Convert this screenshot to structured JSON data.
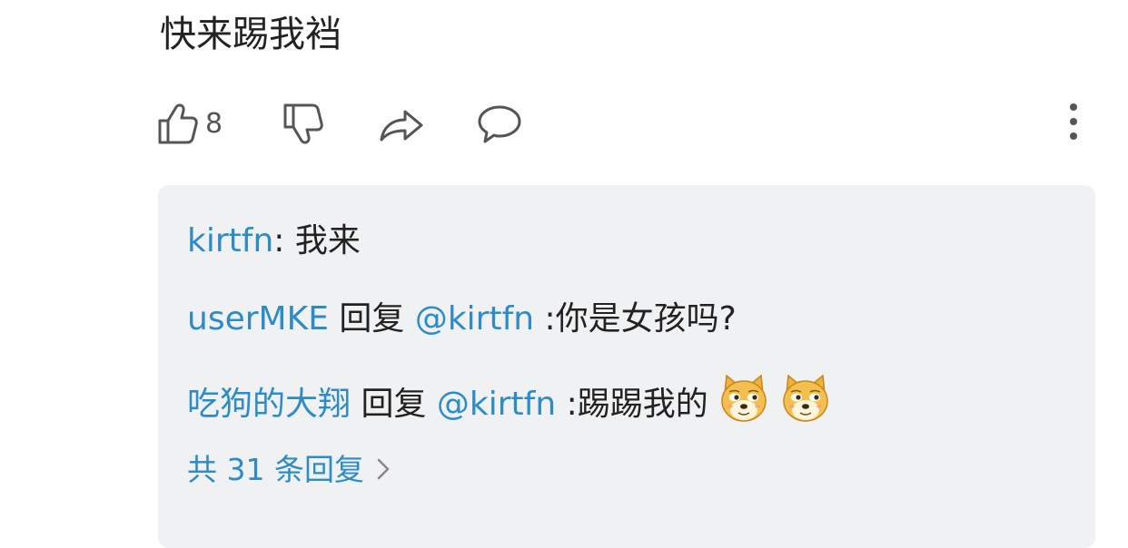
{
  "comment": {
    "text": "快来踢我裆",
    "like_count": "8"
  },
  "actions": {
    "like_icon": "thumbs-up-icon",
    "dislike_icon": "thumbs-down-icon",
    "share_icon": "share-icon",
    "reply_icon": "comment-bubble-icon",
    "more_icon": "more-vertical-icon"
  },
  "replies": [
    {
      "user": "kirtfn",
      "separator": ": ",
      "text": "我来"
    },
    {
      "user": "userMKE",
      "verb": " 回复 ",
      "mention": "@kirtfn",
      "text": " :你是女孩吗?"
    },
    {
      "user": "吃狗的大翔",
      "verb": " 回复 ",
      "mention": "@kirtfn",
      "text": " :踢踢我的",
      "emojis": [
        "doge-emoji",
        "doge-emoji"
      ]
    }
  ],
  "more_replies_label": "共 31 条回复",
  "colors": {
    "link": "#2d8bc7",
    "box_bg": "#f0f1f3",
    "text": "#222222",
    "icon": "#555555"
  }
}
